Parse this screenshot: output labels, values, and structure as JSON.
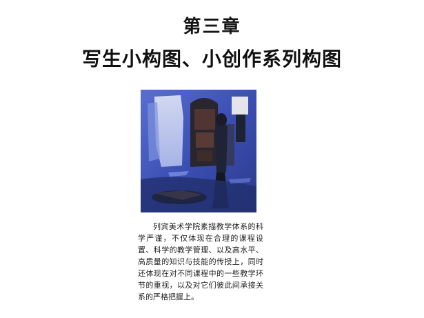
{
  "chapter": {
    "label": "第三章",
    "title": "写生小构图、小创作系列构图"
  },
  "figure": {
    "image": "painting-icon"
  },
  "caption": {
    "text": "列宾美术学院素描教学体系的科学严谨，不仅体现在合理的课程设置、科学的教学管理、以及高水平、高质量的知识与技能的传授上，同时还体现在对不同课程中的一些教学环节的重视，以及对它们彼此间承接关系的严格把握上。"
  },
  "colors": {
    "painting_blue": "#3a4fb0",
    "painting_dark": "#1c1f2e",
    "text": "#222222"
  }
}
